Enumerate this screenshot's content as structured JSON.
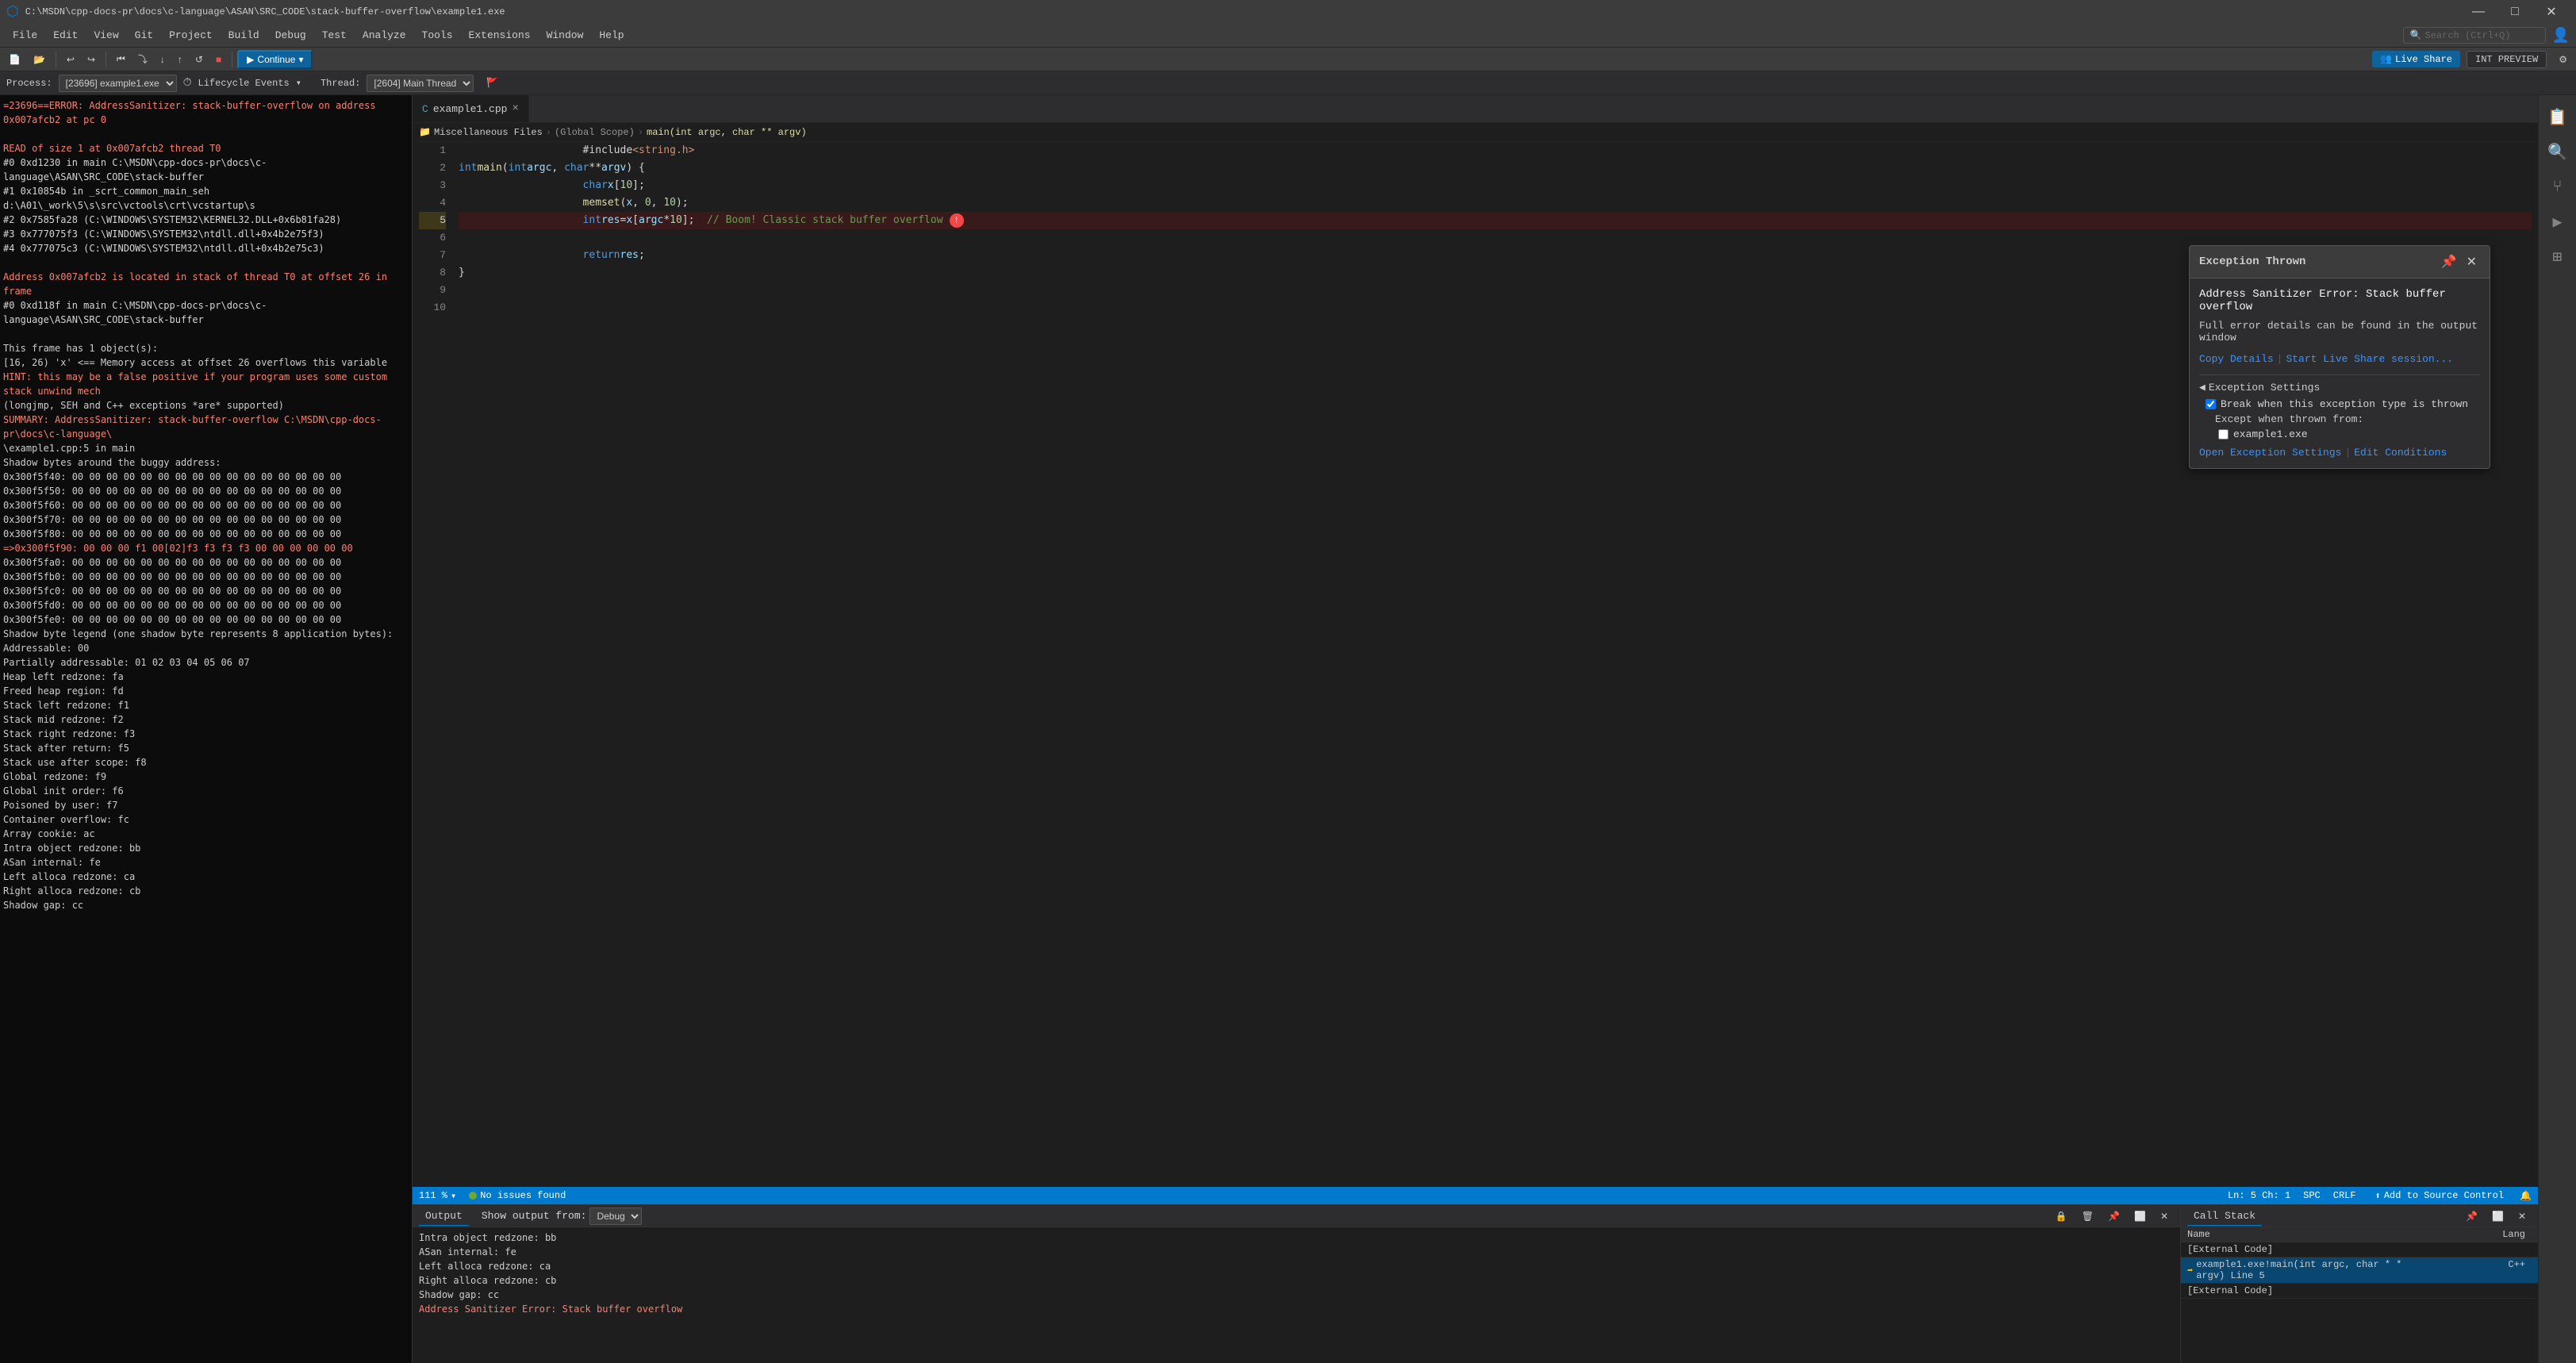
{
  "titleBar": {
    "title": "C:\\MSDN\\cpp-docs-pr\\docs\\c-language\\ASAN\\SRC_CODE\\stack-buffer-overflow\\example1.exe",
    "controls": [
      "—",
      "□",
      "✕"
    ]
  },
  "menuBar": {
    "items": [
      "File",
      "Edit",
      "View",
      "Git",
      "Project",
      "Build",
      "Debug",
      "Test",
      "Analyze",
      "Tools",
      "Extensions",
      "Window",
      "Help"
    ]
  },
  "toolbar": {
    "searchPlaceholder": "Search (Ctrl+Q)",
    "continueLabel": "Continue",
    "continueDropdown": "▾",
    "liveShareLabel": "Live Share",
    "intPreviewLabel": "INT PREVIEW"
  },
  "debugBar": {
    "processLabel": "Process:",
    "processValue": "[23696] example1.exe",
    "lifecycleLabel": "Lifecycle Events",
    "threadLabel": "Thread:",
    "threadValue": "[2604] Main Thread"
  },
  "editorTabs": [
    {
      "name": "example1.cpp",
      "active": true
    },
    {
      "name": "×",
      "isClose": true
    }
  ],
  "breadcrumb": {
    "folder": "Miscellaneous Files",
    "scope": "(Global Scope)",
    "function": "main(int argc, char ** argv)"
  },
  "lineNumbers": [
    1,
    2,
    3,
    4,
    5,
    6,
    7,
    8,
    9,
    10
  ],
  "codeLines": [
    {
      "num": 1,
      "text": "        #include <string.h>"
    },
    {
      "num": 2,
      "text": "int main(int argc, char **argv) {"
    },
    {
      "num": 3,
      "text": "        char x[10];"
    },
    {
      "num": 4,
      "text": "        memset(x, 0, 10);"
    },
    {
      "num": 5,
      "text": "        int res = x[argc * 10];  // Boom! Classic stack buffer overflow",
      "hasError": true
    },
    {
      "num": 6,
      "text": ""
    },
    {
      "num": 7,
      "text": "        return res;"
    },
    {
      "num": 8,
      "text": "}"
    },
    {
      "num": 9,
      "text": ""
    },
    {
      "num": 10,
      "text": ""
    }
  ],
  "editorStatus": {
    "zoomLabel": "111 %",
    "noIssuesIcon": "●",
    "noIssuesText": "No issues found",
    "lineCol": "Ln: 5   Ch: 1",
    "encoding": "SPC",
    "lineEnding": "CRLF"
  },
  "exceptionPopup": {
    "title": "Exception Thrown",
    "message": "Address Sanitizer Error: Stack buffer overflow",
    "details": "Full error details can be found in the output window",
    "copyDetailsLabel": "Copy Details",
    "separatorLabel": "|",
    "startLiveShareLabel": "Start Live Share session...",
    "settingsSectionTitle": "Exception Settings",
    "checkboxLabel": "Break when this exception type is thrown",
    "exceptLabel": "Except when thrown from:",
    "checkboxExe": "example1.exe",
    "openSettingsLabel": "Open Exception Settings",
    "editConditionsLabel": "Edit Conditions",
    "settingsSeparator": "|"
  },
  "outputPanel": {
    "title": "Output",
    "filterLabel": "Show output from:",
    "filterValue": "Debug",
    "content": [
      "    Intra object redzone:      bb",
      "    ASan internal:              fe",
      "    Left alloca redzone:        ca",
      "    Right alloca redzone:       cb",
      "    Shadow gap:                 cc",
      "Address Sanitizer Error: Stack buffer overflow"
    ]
  },
  "callStackPanel": {
    "title": "Call Stack",
    "columns": [
      "Name",
      "Lang"
    ],
    "rows": [
      {
        "name": "[External Code]",
        "lang": "",
        "active": false,
        "isExternal": true
      },
      {
        "name": "example1.exe!main(int argc, char * * argv) Line 5",
        "lang": "C++",
        "active": true,
        "arrow": true
      },
      {
        "name": "[External Code]",
        "lang": "",
        "active": false,
        "isExternal": true
      }
    ]
  },
  "terminalContent": [
    "=23696==ERROR: AddressSanitizer: stack-buffer-overflow on address 0x007afcb2 at pc 0",
    "",
    "READ of size 1 at 0x007afcb2 thread T0",
    "    #0 0xd1230 in main C:\\MSDN\\cpp-docs-pr\\docs\\c-language\\ASAN\\SRC_CODE\\stack-buffer",
    "    #1 0x10854b in _scrt_common_main_seh d:\\A01\\_work\\5\\s\\src\\vctools\\crt\\vcstartup\\s",
    "    #2 0x7585fa28 (C:\\WINDOWS\\SYSTEM32\\KERNEL32.DLL+0x6b81fa28)",
    "    #3 0x777075f3 (C:\\WINDOWS\\SYSTEM32\\ntdll.dll+0x4b2e75f3)",
    "    #4 0x777075c3 (C:\\WINDOWS\\SYSTEM32\\ntdll.dll+0x4b2e75c3)",
    "",
    "Address 0x007afcb2 is located in stack of thread T0 at offset 26 in frame",
    "    #0 0xd118f in main C:\\MSDN\\cpp-docs-pr\\docs\\c-language\\ASAN\\SRC_CODE\\stack-buffer",
    "",
    "This frame has 1 object(s):",
    "    [16, 26) 'x' <== Memory access at offset 26 overflows this variable",
    "HINT: this may be a false positive if your program uses some custom stack unwind mech",
    "    (longjmp, SEH and C++ exceptions *are* supported)",
    "SUMMARY: AddressSanitizer: stack-buffer-overflow C:\\MSDN\\cpp-docs-pr\\docs\\c-language\\",
    "\\example1.cpp:5 in main",
    "Shadow bytes around the buggy address:",
    "  0x300f5f40: 00 00 00 00 00 00 00 00 00 00 00 00 00 00 00 00",
    "  0x300f5f50: 00 00 00 00 00 00 00 00 00 00 00 00 00 00 00 00",
    "  0x300f5f60: 00 00 00 00 00 00 00 00 00 00 00 00 00 00 00 00",
    "  0x300f5f70: 00 00 00 00 00 00 00 00 00 00 00 00 00 00 00 00",
    "  0x300f5f80: 00 00 00 00 00 00 00 00 00 00 00 00 00 00 00 00",
    "=>0x300f5f90: 00 00 00 f1 00[02]f3 f3 f3 f3 00 00 00 00 00 00",
    "  0x300f5fa0: 00 00 00 00 00 00 00 00 00 00 00 00 00 00 00 00",
    "  0x300f5fb0: 00 00 00 00 00 00 00 00 00 00 00 00 00 00 00 00",
    "  0x300f5fc0: 00 00 00 00 00 00 00 00 00 00 00 00 00 00 00 00",
    "  0x300f5fd0: 00 00 00 00 00 00 00 00 00 00 00 00 00 00 00 00",
    "  0x300f5fe0: 00 00 00 00 00 00 00 00 00 00 00 00 00 00 00 00",
    "Shadow byte legend (one shadow byte represents 8 application bytes):",
    "  Addressable:           00",
    "  Partially addressable: 01 02 03 04 05 06 07",
    "  Heap left redzone:       fa",
    "  Freed heap region:       fd",
    "  Stack left redzone:      f1",
    "  Stack mid redzone:       f2",
    "  Stack right redzone:     f3",
    "  Stack after return:      f5",
    "  Stack use after scope:   f8",
    "  Global redzone:          f9",
    "  Global init order:       f6",
    "  Poisoned by user:        f7",
    "  Container overflow:      fc",
    "  Array cookie:            ac",
    "  Intra object redzone:    bb",
    "  ASan internal:           fe",
    "  Left alloca redzone:     ca",
    "  Right alloca redzone:    cb",
    "  Shadow gap:              cc"
  ]
}
